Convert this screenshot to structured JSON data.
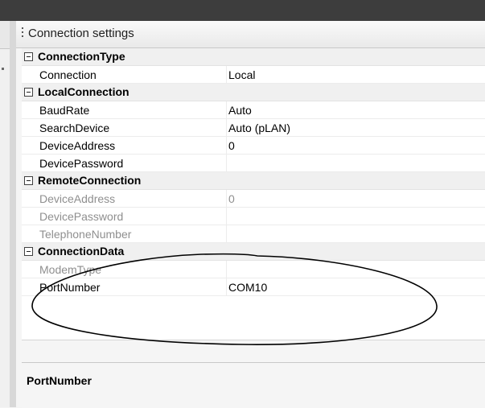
{
  "panel": {
    "title": "Connection settings"
  },
  "property_grid": {
    "categories": [
      {
        "label": "ConnectionType",
        "rows": [
          {
            "name": "Connection",
            "value": "Local",
            "enabled": true
          }
        ]
      },
      {
        "label": "LocalConnection",
        "rows": [
          {
            "name": "BaudRate",
            "value": "Auto",
            "enabled": true
          },
          {
            "name": "SearchDevice",
            "value": "Auto (pLAN)",
            "enabled": true
          },
          {
            "name": "DeviceAddress",
            "value": "0",
            "enabled": true
          },
          {
            "name": "DevicePassword",
            "value": "",
            "enabled": true
          }
        ]
      },
      {
        "label": "RemoteConnection",
        "rows": [
          {
            "name": "DeviceAddress",
            "value": "0",
            "enabled": false
          },
          {
            "name": "DevicePassword",
            "value": "",
            "enabled": false
          },
          {
            "name": "TelephoneNumber",
            "value": "",
            "enabled": false
          }
        ]
      },
      {
        "label": "ConnectionData",
        "rows": [
          {
            "name": "ModemType",
            "value": "",
            "enabled": false
          },
          {
            "name": "PortNumber",
            "value": "COM10",
            "enabled": true
          }
        ]
      }
    ],
    "collapse_glyph": "minus-box-icon"
  },
  "description": {
    "title": "PortNumber"
  },
  "colors": {
    "topbar": "#3d3d3d",
    "disabled_text": "#8f8f8f",
    "annotation_stroke": "#000000"
  }
}
